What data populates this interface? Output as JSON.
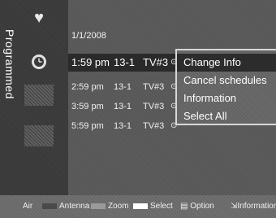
{
  "sidebar": {
    "label": "Programmed",
    "icons": [
      "heart-icon",
      "schedule-icon"
    ]
  },
  "list": {
    "date": "1/1/2008",
    "rows": [
      {
        "time": "1:59 pm",
        "channel": "13-1",
        "name": "TV#3",
        "clock": "⊙"
      },
      {
        "time": "2:59 pm",
        "channel": "13-1",
        "name": "TV#3",
        "clock": "⊙"
      },
      {
        "time": "3:59 pm",
        "channel": "13-1",
        "name": "TV#3",
        "clock": "⊙"
      },
      {
        "time": "5:59 pm",
        "channel": "13-1",
        "name": "TV#3",
        "clock": "⊙"
      }
    ]
  },
  "popup": {
    "items": [
      "Change Info",
      "Cancel schedules",
      "Information",
      "Select All"
    ]
  },
  "footer": {
    "air": "Air",
    "antenna": "Antenna",
    "zoom": "Zoom",
    "select": "Select",
    "option": "Option",
    "information": "Information"
  },
  "colors": {
    "swatch_antenna": "#4a4a4a",
    "swatch_zoom": "#9a9a9a",
    "swatch_select": "#ffffff"
  }
}
